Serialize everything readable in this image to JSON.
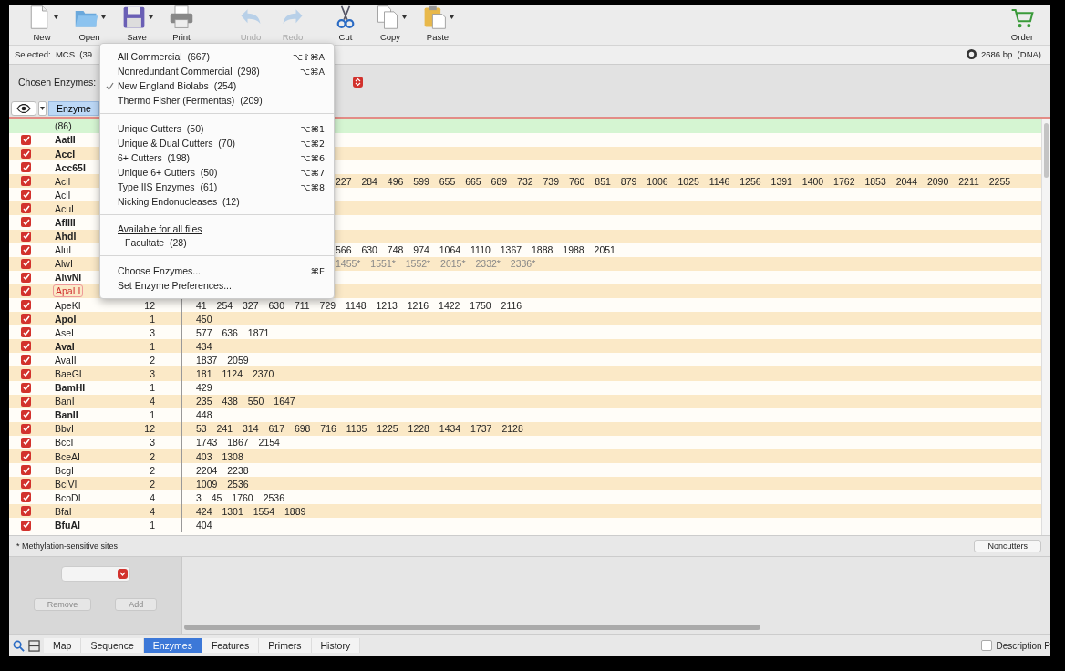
{
  "toolbar": [
    {
      "kind": "new",
      "label": "New",
      "disabled": false,
      "has_menu": true
    },
    {
      "kind": "open",
      "label": "Open",
      "disabled": false,
      "has_menu": true
    },
    {
      "kind": "save",
      "label": "Save",
      "disabled": false,
      "has_menu": true
    },
    {
      "kind": "print",
      "label": "Print",
      "disabled": false,
      "has_menu": false
    },
    {
      "kind": "undo",
      "label": "Undo",
      "disabled": true,
      "has_menu": false
    },
    {
      "kind": "redo",
      "label": "Redo",
      "disabled": true,
      "has_menu": false
    },
    {
      "kind": "cut",
      "label": "Cut",
      "disabled": false,
      "has_menu": false
    },
    {
      "kind": "copy",
      "label": "Copy",
      "disabled": false,
      "has_menu": true
    },
    {
      "kind": "paste",
      "label": "Paste",
      "disabled": false,
      "has_menu": true
    }
  ],
  "order_button": "Order",
  "status_bar": {
    "selection": "Selected:  MCS  (39",
    "length": "2686 bp  (DNA)"
  },
  "chosen_enzymes_label": "Chosen Enzymes:",
  "table": {
    "column_header": "Enzyme",
    "summary": "(86)",
    "rows": [
      {
        "name": "AatII",
        "bold": true,
        "highlighted": false,
        "checked": true
      },
      {
        "name": "AccI",
        "bold": true,
        "highlighted": false,
        "checked": true
      },
      {
        "name": "Acc65I",
        "bold": true,
        "highlighted": false,
        "checked": true
      },
      {
        "name": "AciI",
        "bold": false,
        "highlighted": false,
        "checked": true,
        "sites": "227 284 496 599 655 665 689 732 739 760 851 879 1006 1025 1146 1256 1391 1400 1762 1853 2044 2090 2211 2255",
        "methylation": false
      },
      {
        "name": "AclI",
        "bold": false,
        "highlighted": false,
        "checked": true
      },
      {
        "name": "AcuI",
        "bold": false,
        "highlighted": false,
        "checked": true
      },
      {
        "name": "AflIII",
        "bold": true,
        "highlighted": false,
        "checked": true
      },
      {
        "name": "AhdI",
        "bold": true,
        "highlighted": false,
        "checked": true
      },
      {
        "name": "AluI",
        "bold": false,
        "highlighted": false,
        "checked": true,
        "sites": "566 630 748 974 1064 1110 1367 1888 1988 2051",
        "methylation": false
      },
      {
        "name": "AlwI",
        "bold": false,
        "highlighted": false,
        "checked": true,
        "sites": "1455* 1551* 1552* 2015* 2332* 2336*",
        "methylation": true
      },
      {
        "name": "AlwNI",
        "bold": true,
        "highlighted": false,
        "checked": true
      },
      {
        "name": "ApaLI",
        "bold": false,
        "highlighted": true,
        "checked": true
      },
      {
        "name": "ApeKI",
        "bold": false,
        "highlighted": false,
        "checked": true,
        "count": "12",
        "sites": "41 254 327 630 711 729 1148 1213 1216 1422 1750 2116",
        "methylation": false
      },
      {
        "name": "ApoI",
        "bold": true,
        "highlighted": false,
        "checked": true,
        "count": "1",
        "sites": "450",
        "methylation": false
      },
      {
        "name": "AseI",
        "bold": false,
        "highlighted": false,
        "checked": true,
        "count": "3",
        "sites": "577 636 1871",
        "methylation": false
      },
      {
        "name": "AvaI",
        "bold": true,
        "highlighted": false,
        "checked": true,
        "count": "1",
        "sites": "434",
        "methylation": false
      },
      {
        "name": "AvaII",
        "bold": false,
        "highlighted": false,
        "checked": true,
        "count": "2",
        "sites": "1837 2059",
        "methylation": false
      },
      {
        "name": "BaeGI",
        "bold": false,
        "highlighted": false,
        "checked": true,
        "count": "3",
        "sites": "181 1124 2370",
        "methylation": false
      },
      {
        "name": "BamHI",
        "bold": true,
        "highlighted": false,
        "checked": true,
        "count": "1",
        "sites": "429",
        "methylation": false
      },
      {
        "name": "BanI",
        "bold": false,
        "highlighted": false,
        "checked": true,
        "count": "4",
        "sites": "235 438 550 1647",
        "methylation": false
      },
      {
        "name": "BanII",
        "bold": true,
        "highlighted": false,
        "checked": true,
        "count": "1",
        "sites": "448",
        "methylation": false
      },
      {
        "name": "BbvI",
        "bold": false,
        "highlighted": false,
        "checked": true,
        "count": "12",
        "sites": "53 241 314 617 698 716 1135 1225 1228 1434 1737 2128",
        "methylation": false
      },
      {
        "name": "BccI",
        "bold": false,
        "highlighted": false,
        "checked": true,
        "count": "3",
        "sites": "1743 1867 2154",
        "methylation": false
      },
      {
        "name": "BceAI",
        "bold": false,
        "highlighted": false,
        "checked": true,
        "count": "2",
        "sites": "403 1308",
        "methylation": false
      },
      {
        "name": "BcgI",
        "bold": false,
        "highlighted": false,
        "checked": true,
        "count": "2",
        "sites": "2204 2238",
        "methylation": false
      },
      {
        "name": "BciVI",
        "bold": false,
        "highlighted": false,
        "checked": true,
        "count": "2",
        "sites": "1009 2536",
        "methylation": false
      },
      {
        "name": "BcoDI",
        "bold": false,
        "highlighted": false,
        "checked": true,
        "count": "4",
        "sites": "3 45 1760 2536",
        "methylation": false
      },
      {
        "name": "BfaI",
        "bold": false,
        "highlighted": false,
        "checked": true,
        "count": "4",
        "sites": "424 1301 1554 1889",
        "methylation": false
      },
      {
        "name": "BfuAI",
        "bold": true,
        "highlighted": false,
        "checked": true,
        "count": "1",
        "sites": "404",
        "methylation": false
      }
    ]
  },
  "footnote": "* Methylation-sensitive sites",
  "noncutters_button": "Noncutters",
  "remove_button": {
    "label": "Remove",
    "disabled": true
  },
  "add_button": {
    "label": "Add",
    "disabled": true
  },
  "tabs": [
    {
      "label": "Map",
      "selected": false
    },
    {
      "label": "Sequence",
      "selected": false
    },
    {
      "label": "Enzymes",
      "selected": true
    },
    {
      "label": "Features",
      "selected": false
    },
    {
      "label": "Primers",
      "selected": false
    },
    {
      "label": "History",
      "selected": false
    }
  ],
  "description_checkbox": {
    "label": "Description P",
    "checked": false
  },
  "menu": {
    "sections": [
      {
        "items": [
          {
            "label": "All Commercial  (667)",
            "shortcut": "⌥⇧⌘A",
            "checked": false
          },
          {
            "label": "Nonredundant Commercial  (298)",
            "shortcut": "⌥⌘A",
            "checked": false
          },
          {
            "label": "New England Biolabs  (254)",
            "checked": true
          },
          {
            "label": "Thermo Fisher (Fermentas)  (209)",
            "checked": false
          }
        ]
      },
      {
        "items": [
          {
            "label": "Unique Cutters  (50)",
            "shortcut": "⌥⌘1",
            "checked": false
          },
          {
            "label": "Unique & Dual Cutters  (70)",
            "shortcut": "⌥⌘2",
            "checked": false
          },
          {
            "label": "6+ Cutters  (198)",
            "shortcut": "⌥⌘6",
            "checked": false
          },
          {
            "label": "Unique 6+ Cutters  (50)",
            "shortcut": "⌥⌘7",
            "checked": false
          },
          {
            "label": "Type IIS Enzymes  (61)",
            "shortcut": "⌥⌘8",
            "checked": false
          },
          {
            "label": "Nicking Endonucleases  (12)",
            "checked": false
          }
        ]
      },
      {
        "header": "Available for all files",
        "items": [
          {
            "label": "Facultate  (28)",
            "checked": false
          }
        ]
      },
      {
        "items": [
          {
            "label": "Choose Enzymes...",
            "shortcut": "⌘E",
            "checked": false
          },
          {
            "label": "Set Enzyme Preferences...",
            "checked": false
          }
        ]
      }
    ]
  }
}
